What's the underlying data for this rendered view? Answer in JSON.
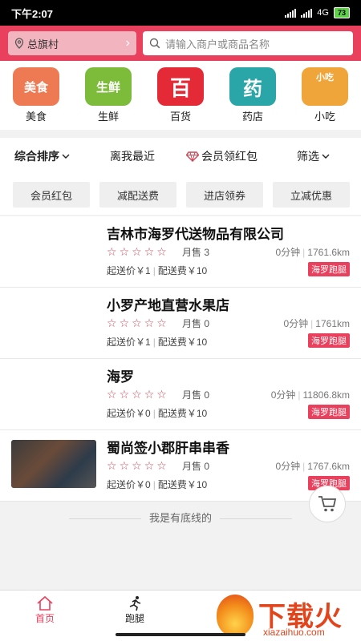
{
  "status_bar": {
    "time": "下午2:07",
    "network": "4G",
    "battery": "73"
  },
  "header": {
    "location": "总旗村",
    "search_placeholder": "请输入商户或商品名称"
  },
  "categories": [
    {
      "label": "美食",
      "icon_text": "美食",
      "icon": "food-icon"
    },
    {
      "label": "生鲜",
      "icon_text": "生鲜",
      "icon": "fresh-icon"
    },
    {
      "label": "百货",
      "icon_text": "百",
      "icon": "department-store-icon"
    },
    {
      "label": "药店",
      "icon_text": "药",
      "icon": "pharmacy-icon"
    },
    {
      "label": "小吃",
      "icon_text": "小吃",
      "icon": "snack-icon"
    }
  ],
  "sort_bar": {
    "comprehensive": "综合排序",
    "nearest": "离我最近",
    "member_red_packet": "会员领红包",
    "filter": "筛选"
  },
  "filter_chips": [
    "会员红包",
    "减配送费",
    "进店领券",
    "立减优惠"
  ],
  "stores": [
    {
      "name": "吉林市海罗代送物品有限公司",
      "monthly_sales": "月售 3",
      "time": "0分钟",
      "distance": "1761.6km",
      "min_order": "起送价￥1",
      "delivery_fee": "配送费￥10",
      "badge": "海罗跑腿",
      "stars": 5
    },
    {
      "name": "小罗产地直营水果店",
      "monthly_sales": "月售 0",
      "time": "0分钟",
      "distance": "1761km",
      "min_order": "起送价￥1",
      "delivery_fee": "配送费￥10",
      "badge": "海罗跑腿",
      "stars": 5
    },
    {
      "name": "海罗",
      "monthly_sales": "月售 0",
      "time": "0分钟",
      "distance": "11806.8km",
      "min_order": "起送价￥0",
      "delivery_fee": "配送费￥10",
      "badge": "海罗跑腿",
      "stars": 5
    },
    {
      "name": "蜀尚签小郡肝串串香",
      "monthly_sales": "月售 0",
      "time": "0分钟",
      "distance": "1767.6km",
      "min_order": "起送价￥0",
      "delivery_fee": "配送费￥10",
      "badge": "海罗跑腿",
      "stars": 5
    }
  ],
  "end_of_list": "我是有底线的",
  "tabbar": {
    "home": "首页",
    "errand": "跑腿"
  },
  "watermark": {
    "title": "下载火",
    "site": "xiazaihuo.com"
  },
  "colors": {
    "brand": "#e9405d",
    "star": "#c94a58"
  }
}
